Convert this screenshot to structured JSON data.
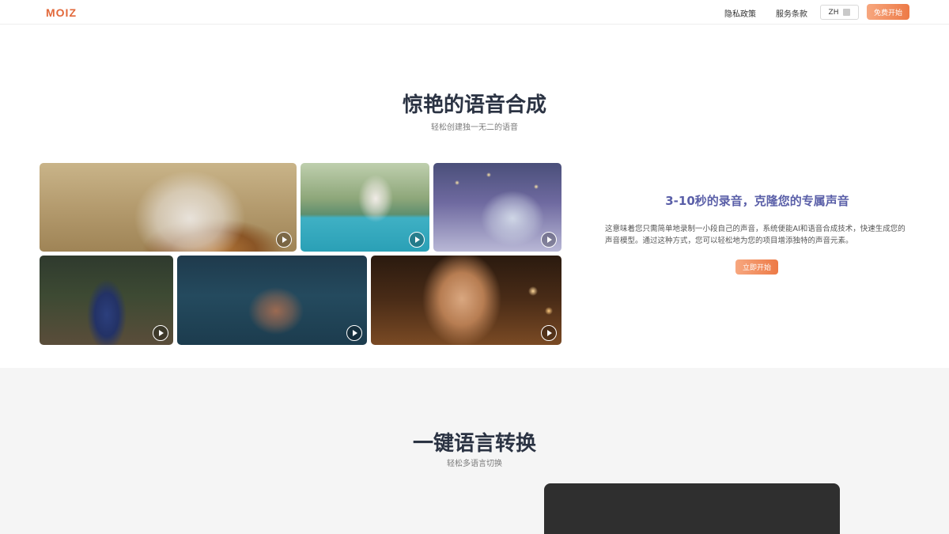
{
  "header": {
    "logo": "MOIZ",
    "nav": {
      "privacy": "隐私政策",
      "terms": "服务条款"
    },
    "language": "ZH",
    "start_label": "免费开始"
  },
  "hero": {
    "title": "惊艳的语音合成",
    "subtitle": "轻松创建独一无二的语音"
  },
  "gallery": [
    {
      "name": "woman-with-lion",
      "icon": "play-icon"
    },
    {
      "name": "woman-by-pool",
      "icon": "play-icon"
    },
    {
      "name": "dragon-plush-bed",
      "icon": "play-icon"
    },
    {
      "name": "witch-in-forest",
      "icon": "play-icon"
    },
    {
      "name": "man-swimming",
      "icon": "play-icon"
    },
    {
      "name": "woman-closeup",
      "icon": "play-icon"
    }
  ],
  "feature": {
    "title": "3-10秒的录音，克隆您的专属声音",
    "description": "这意味着您只需简单地录制一小段自己的声音，系统便能AI和语音合成技术，快速生成您的声音模型。通过这种方式，您可以轻松地为您的项目增添独特的声音元素。",
    "cta": "立即开始"
  },
  "section2": {
    "title": "一键语言转换",
    "subtitle": "轻松多语言切换"
  },
  "colors": {
    "accent": "#ed7a46",
    "title": "#2b3343",
    "feature_title": "#5a5fa8"
  }
}
